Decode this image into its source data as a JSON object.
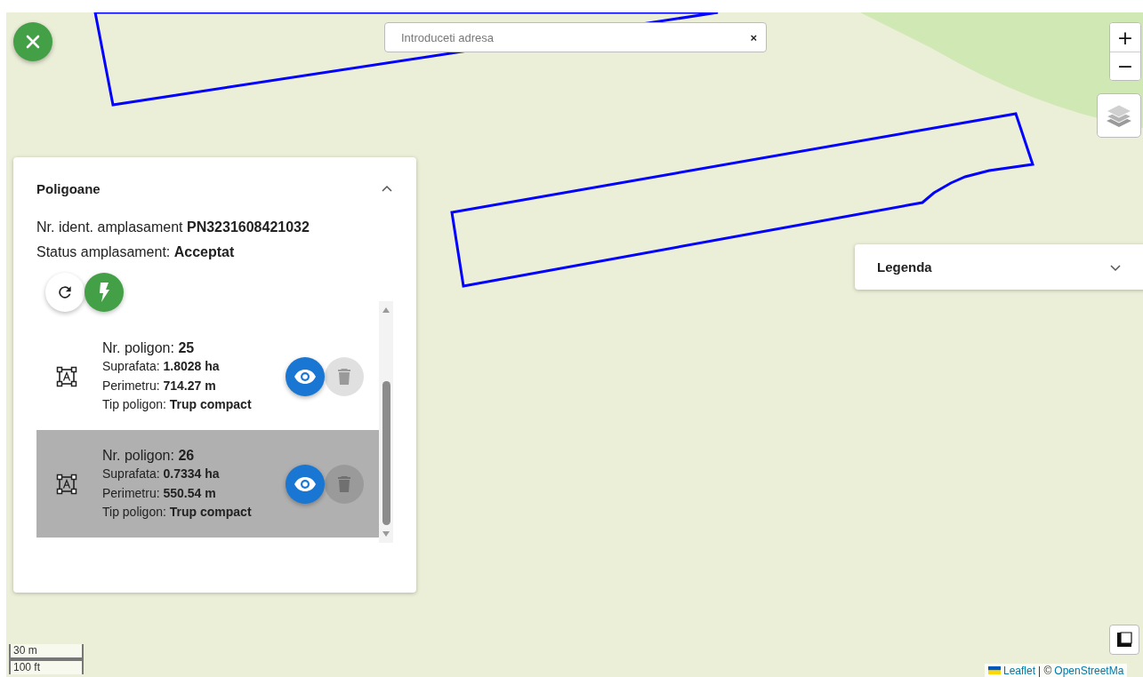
{
  "search": {
    "placeholder": "Introduceti adresa",
    "clear": "×"
  },
  "zoom": {
    "in": "+",
    "out": "−"
  },
  "panel": {
    "title": "Poligoane",
    "expanded": true,
    "ident_label": "Nr. ident. amplasament",
    "ident_value": "PN3231608421032",
    "status_label": "Status amplasament:",
    "status_value": "Acceptat",
    "polygons": [
      {
        "nr_label": "Nr. poligon:",
        "nr": "25",
        "area_label": "Suprafata:",
        "area": "1.8028 ha",
        "perim_label": "Perimetru:",
        "perim": "714.27 m",
        "type_label": "Tip poligon:",
        "type": "Trup compact",
        "selected": false
      },
      {
        "nr_label": "Nr. poligon:",
        "nr": "26",
        "area_label": "Suprafata:",
        "area": "0.7334 ha",
        "perim_label": "Perimetru:",
        "perim": "550.54 m",
        "type_label": "Tip poligon:",
        "type": "Trup compact",
        "selected": true
      }
    ]
  },
  "legend": {
    "title": "Legenda",
    "expanded": false
  },
  "scale": {
    "metric": "30 m",
    "imperial": "100 ft"
  },
  "attribution": {
    "leaflet": "Leaflet",
    "separator": "| ©",
    "osm": "OpenStreetMa"
  }
}
